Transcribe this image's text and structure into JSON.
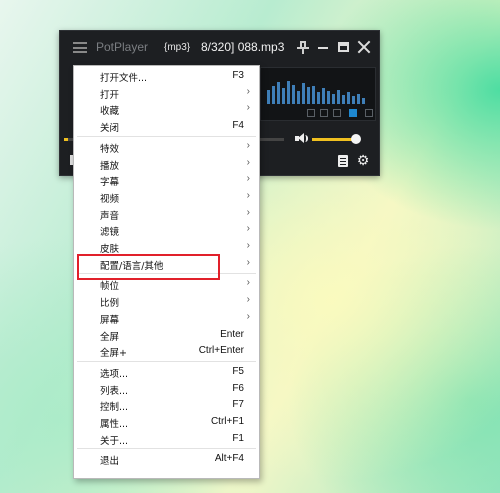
{
  "player": {
    "app_name": "PotPlayer",
    "file_ext": "{mp3}",
    "file_name": "8/320] 088.mp3",
    "progress": 0.02,
    "volume": 0.95,
    "accent_color": "#f0c020",
    "icons": [
      "hamburger-menu-icon",
      "pin-icon",
      "minimize-icon",
      "maximize-icon",
      "close-icon",
      "volume-icon",
      "playlist-icon",
      "settings-gear-icon"
    ]
  },
  "menu": {
    "groups": [
      [
        {
          "label": "打开文件...",
          "shortcut": "F3",
          "submenu": false
        },
        {
          "label": "打开",
          "shortcut": "",
          "submenu": true
        },
        {
          "label": "收藏",
          "shortcut": "",
          "submenu": true
        },
        {
          "label": "关闭",
          "shortcut": "F4",
          "submenu": false
        }
      ],
      [
        {
          "label": "特效",
          "shortcut": "",
          "submenu": true
        },
        {
          "label": "播放",
          "shortcut": "",
          "submenu": true
        },
        {
          "label": "字幕",
          "shortcut": "",
          "submenu": true
        },
        {
          "label": "视频",
          "shortcut": "",
          "submenu": true
        },
        {
          "label": "声音",
          "shortcut": "",
          "submenu": true
        },
        {
          "label": "滤镜",
          "shortcut": "",
          "submenu": true
        },
        {
          "label": "皮肤",
          "shortcut": "",
          "submenu": true
        },
        {
          "label": "配置/语言/其他",
          "shortcut": "",
          "submenu": true,
          "highlighted": true
        }
      ],
      [
        {
          "label": "帧位",
          "shortcut": "",
          "submenu": true
        },
        {
          "label": "比例",
          "shortcut": "",
          "submenu": true
        },
        {
          "label": "屏幕",
          "shortcut": "",
          "submenu": true
        },
        {
          "label": "全屏",
          "shortcut": "Enter",
          "submenu": false
        },
        {
          "label": "全屏+",
          "shortcut": "Ctrl+Enter",
          "submenu": false
        }
      ],
      [
        {
          "label": "选项...",
          "shortcut": "F5",
          "submenu": false
        },
        {
          "label": "列表...",
          "shortcut": "F6",
          "submenu": false
        },
        {
          "label": "控制...",
          "shortcut": "F7",
          "submenu": false
        },
        {
          "label": "属性...",
          "shortcut": "Ctrl+F1",
          "submenu": false
        },
        {
          "label": "关于...",
          "shortcut": "F1",
          "submenu": false
        }
      ],
      [
        {
          "label": "退出",
          "shortcut": "Alt+F4",
          "submenu": false
        }
      ]
    ],
    "arrow_glyph": "›",
    "highlight_color": "#e1202a"
  }
}
